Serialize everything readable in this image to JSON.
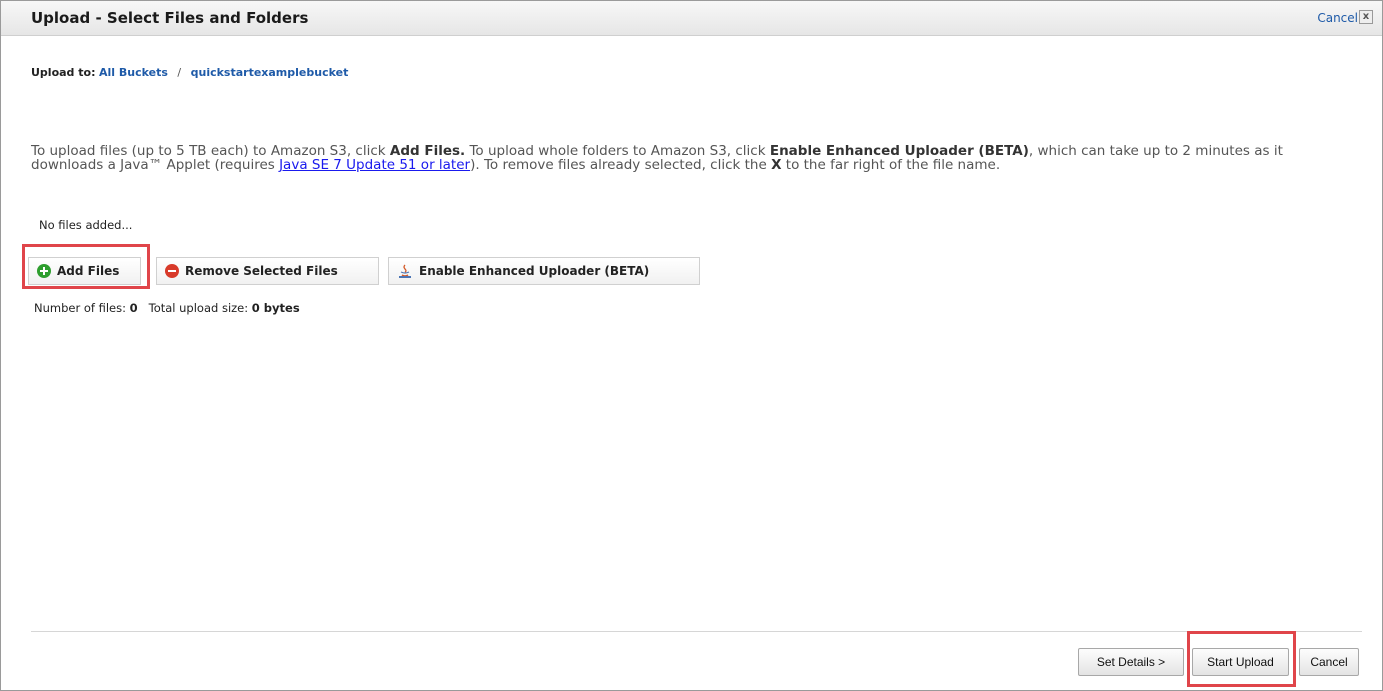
{
  "dialog": {
    "title": "Upload - Select Files and Folders",
    "cancel_label": "Cancel",
    "close_glyph": "x"
  },
  "upload_to": {
    "label": "Upload to:",
    "crumbs": [
      "All Buckets",
      "quickstartexamplebucket"
    ],
    "separator": "/"
  },
  "instructions": {
    "p1": "To upload files (up to 5 TB each) to Amazon S3, click ",
    "b1": "Add Files.",
    "p2": " To upload whole folders to Amazon S3, click ",
    "b2": "Enable Enhanced Uploader (BETA)",
    "p3": ", which can take up to 2 minutes as it downloads a Java™ Applet (requires ",
    "link": "Java SE 7 Update 51 or later",
    "p4": "). To remove files already selected, click the ",
    "b3": "X",
    "p5": " to the far right of the file name."
  },
  "files": {
    "empty_text": "No files added..."
  },
  "actions": {
    "add_files": "Add Files",
    "remove_selected": "Remove Selected Files",
    "enhanced_uploader": "Enable Enhanced Uploader (BETA)"
  },
  "summary": {
    "count_label": "Number of files:",
    "count_value": "0",
    "size_label": "Total upload size:",
    "size_value": "0 bytes"
  },
  "footer": {
    "set_details": "Set Details >",
    "start_upload": "Start Upload",
    "cancel": "Cancel"
  },
  "colors": {
    "link": "#1e5aa8",
    "highlight": "#e0454a",
    "add_icon": "#2e9e2e",
    "remove_icon": "#d83a2a"
  },
  "icons": [
    "plus-circle-icon",
    "minus-circle-icon",
    "java-icon",
    "close-icon"
  ]
}
